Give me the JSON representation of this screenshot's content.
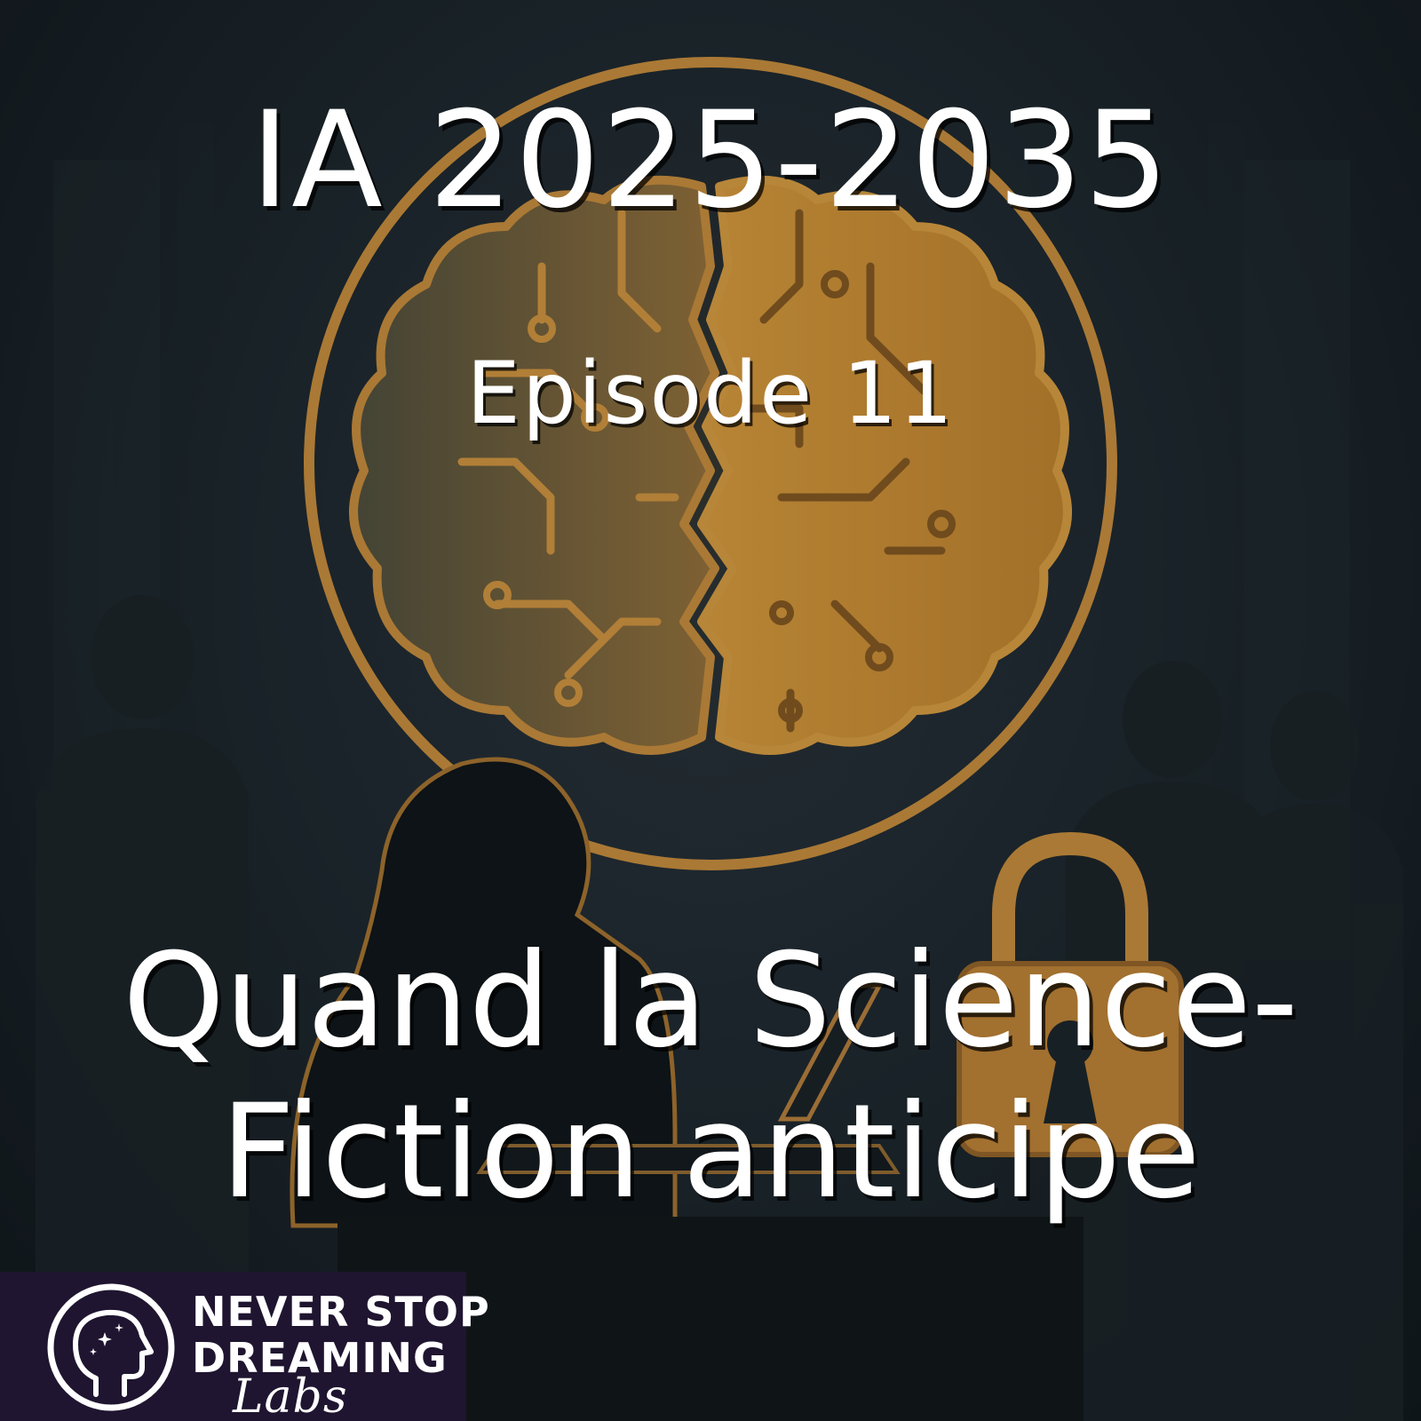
{
  "poster": {
    "title": "IA 2025-2035",
    "episode": "Episode 11",
    "subtitle_line1": "Quand la Science-",
    "subtitle_line2": "Fiction anticipe"
  },
  "brand": {
    "line1": "NEVER STOP",
    "line2": "DREAMING",
    "line3": "Labs"
  },
  "icons": [
    "brain-circuit-icon",
    "padlock-icon",
    "head-stars-icon"
  ],
  "colors": {
    "background": "#1a2329",
    "accent_gold": "#c8903a",
    "text": "#ffffff",
    "brand_bg": "#1f1530"
  }
}
